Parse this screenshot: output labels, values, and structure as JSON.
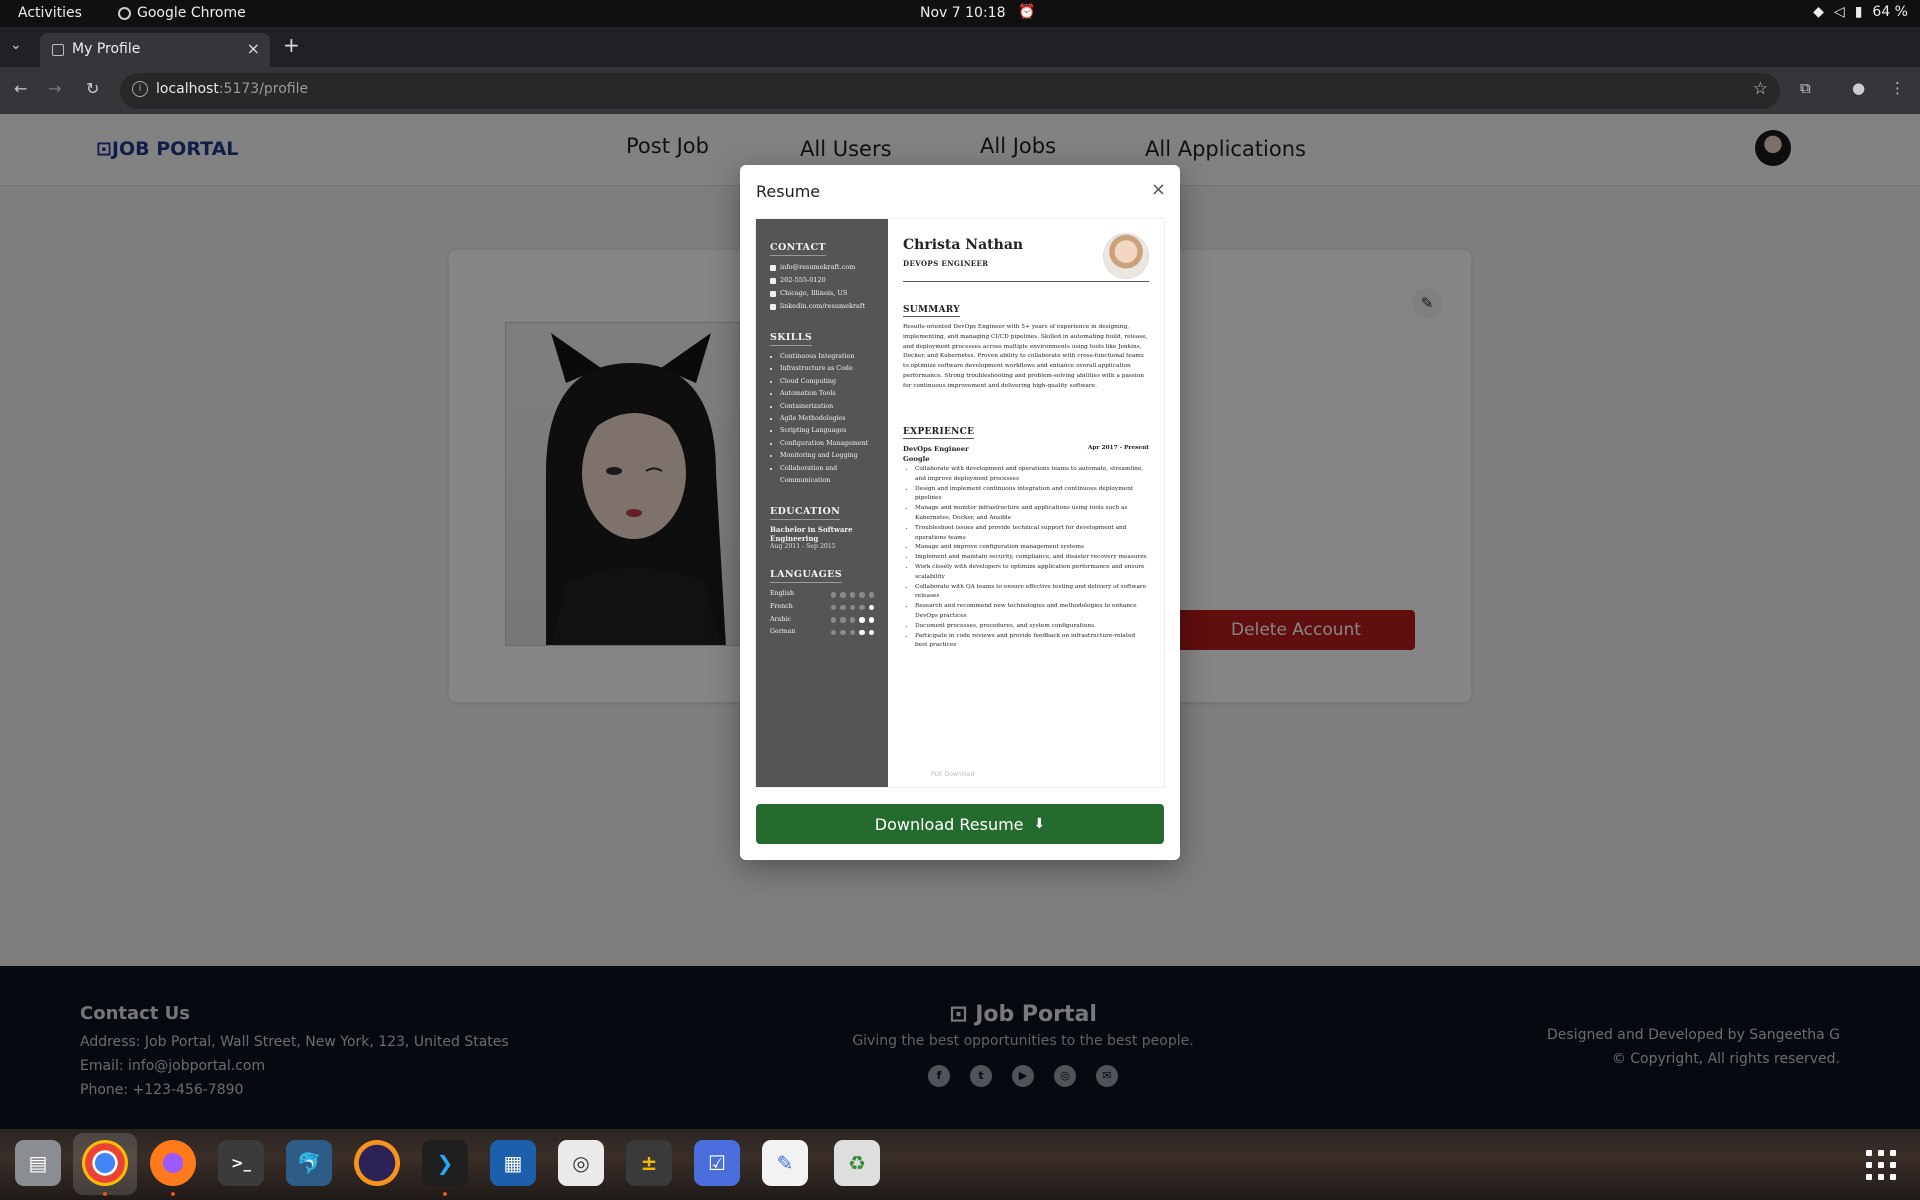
{
  "system": {
    "activities": "Activities",
    "app_name": "Google Chrome",
    "clock": "Nov 7  10:18",
    "battery": "64 %"
  },
  "browser": {
    "tab_title": "My Profile",
    "url_host": "localhost",
    "url_path": ":5173/profile"
  },
  "navbar": {
    "logo": "JOB PORTAL",
    "links": [
      "Post Job",
      "All Users",
      "All Jobs",
      "All Applications"
    ]
  },
  "profile": {
    "delete_label": "Delete Account"
  },
  "modal": {
    "title": "Resume",
    "download_label": "Download Resume"
  },
  "resume": {
    "name": "Christa Nathan",
    "role": "DEVOPS ENGINEER",
    "contact_heading": "CONTACT",
    "contact": [
      "info@resumekraft.com",
      "202-555-0120",
      "Chicago, Illinois, US",
      "linkedin.com/resumekraft"
    ],
    "skills_heading": "SKILLS",
    "skills": [
      "Continuous Integration",
      "Infrastructure as Code",
      "Cloud Computing",
      "Automation Tools",
      "Containerization",
      "Agile Methodologies",
      "Scripting Languages",
      "Configuration Management",
      "Monitoring and Logging",
      "Collaboration and Communication"
    ],
    "education_heading": "EDUCATION",
    "education_title": "Bachelor in Software Engineering",
    "education_date": "Aug 2011 - Sep 2015",
    "languages_heading": "LANGUAGES",
    "languages": [
      {
        "name": "English",
        "level": 0
      },
      {
        "name": "French",
        "level": 1
      },
      {
        "name": "Arabic",
        "level": 2
      },
      {
        "name": "German",
        "level": 2
      }
    ],
    "summary_heading": "SUMMARY",
    "summary": "Results-oriented DevOps Engineer with 5+ years of experience in designing, implementing, and managing CI/CD pipelines. Skilled in automating build, release, and deployment processes across multiple environments using tools like Jenkins, Docker, and Kubernetes. Proven ability to collaborate with cross-functional teams to optimize software development workflows and enhance overall application performance. Strong troubleshooting and problem-solving abilities with a passion for continuous improvement and delivering high-quality software.",
    "experience_heading": "EXPERIENCE",
    "job_title": "DevOps Engineer",
    "job_dates": "Apr 2017 - Present",
    "company": "Google",
    "bullets": [
      "Collaborate with development and operations teams to automate, streamline, and improve deployment processes",
      "Design and implement continuous integration and continuous deployment pipelines",
      "Manage and monitor infrastructure and applications using tools such as Kubernetes, Docker, and Ansible",
      "Troubleshoot issues and provide technical support for development and operations teams",
      "Manage and improve configuration management systems",
      "Implement and maintain security, compliance, and disaster recovery measures",
      "Work closely with developers to optimize application performance and ensure scalability",
      "Collaborate with QA teams to ensure effective testing and delivery of software releases",
      "Research and recommend new technologies and methodologies to enhance DevOps practices",
      "Document processes, procedures, and system configurations.",
      "Participate in code reviews and provide feedback on infrastructure-related best practices"
    ],
    "footnote": "PDF Download"
  },
  "footer": {
    "contact_heading": "Contact Us",
    "address": "Address: Job Portal, Wall Street, New York, 123, United States",
    "email": "Email: info@jobportal.com",
    "phone": "Phone: +123-456-7890",
    "brand": "Job Portal",
    "tagline": "Giving the best opportunities to the best people.",
    "credit1": "Designed and Developed by Sangeetha G",
    "credit2": "© Copyright, All rights reserved."
  },
  "icons": {
    "social": [
      "facebook-icon",
      "twitter-icon",
      "youtube-icon",
      "instagram-icon",
      "mail-icon"
    ]
  },
  "colors": {
    "download": "#256b2e",
    "delete": "#b91c1c",
    "logo": "#1f3a8a"
  }
}
